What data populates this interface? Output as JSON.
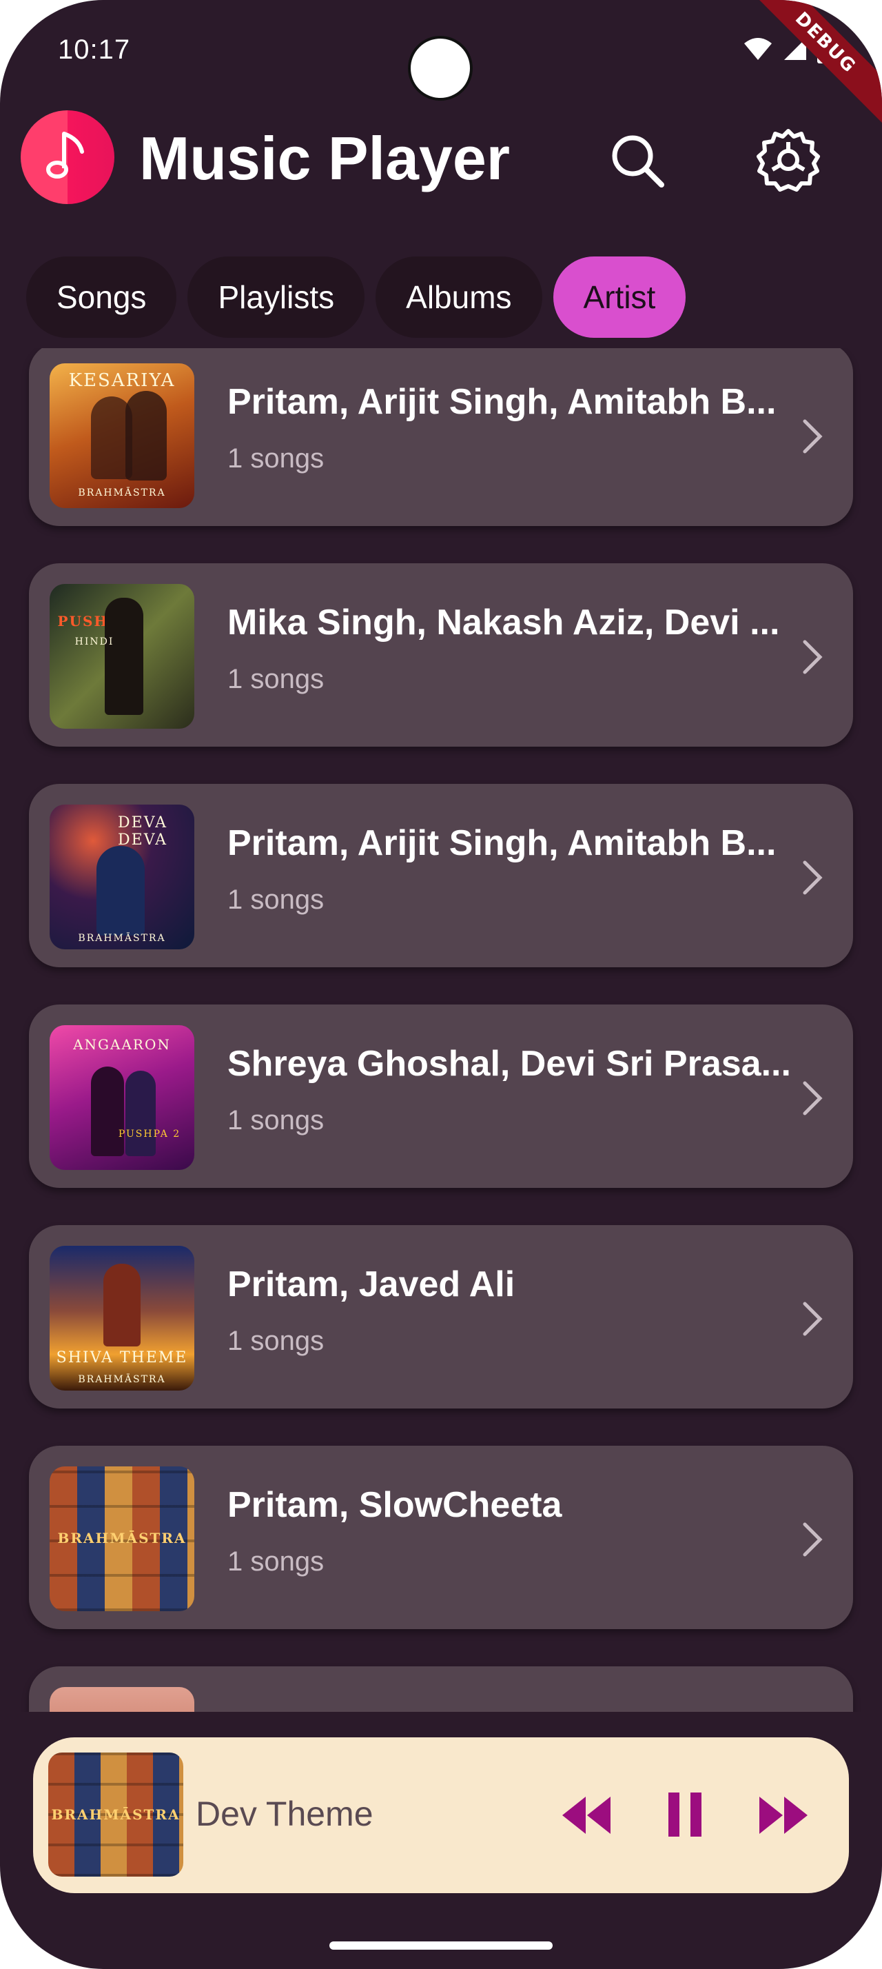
{
  "status_bar": {
    "time": "10:17",
    "debug_label": "DEBUG"
  },
  "app_bar": {
    "title": "Music Player",
    "logo_icon": "music-note-icon",
    "search_icon": "search-icon",
    "settings_icon": "gear-icon"
  },
  "tabs": [
    {
      "label": "Songs",
      "active": false
    },
    {
      "label": "Playlists",
      "active": false
    },
    {
      "label": "Albums",
      "active": false
    },
    {
      "label": "Artist",
      "active": true
    }
  ],
  "artists": [
    {
      "name": "Pritam, Arijit Singh, Amitabh B...",
      "count": "1 songs",
      "art_caption": "KESARIYA",
      "art_sub": "BRAHMĀSTRA"
    },
    {
      "name": "Mika Singh, Nakash Aziz, Devi ...",
      "count": "1 songs",
      "art_caption": "PUSHPA",
      "art_sub": "HINDI"
    },
    {
      "name": "Pritam, Arijit Singh, Amitabh B...",
      "count": "1 songs",
      "art_caption": "DEVA DEVA",
      "art_sub": "BRAHMĀSTRA"
    },
    {
      "name": "Shreya Ghoshal, Devi Sri Prasa...",
      "count": "1 songs",
      "art_caption": "ANGAARON",
      "art_sub": "PUSHPA 2"
    },
    {
      "name": "Pritam, Javed Ali",
      "count": "1 songs",
      "art_caption": "SHIVA THEME",
      "art_sub": "BRAHMĀSTRA"
    },
    {
      "name": "Pritam, SlowCheeta",
      "count": "1 songs",
      "art_caption": "BRAHMĀSTRA",
      "art_sub": ""
    }
  ],
  "mini_player": {
    "title": "Dev Theme",
    "art_caption": "BRAHMĀSTRA",
    "prev_icon": "rewind-icon",
    "pause_icon": "pause-icon",
    "next_icon": "fast-forward-icon"
  },
  "colors": {
    "background": "#2b1a2a",
    "card": "#54444f",
    "accent": "#d94fce",
    "player_bg": "#f9e8cc",
    "player_controls": "#9c0d7f"
  }
}
